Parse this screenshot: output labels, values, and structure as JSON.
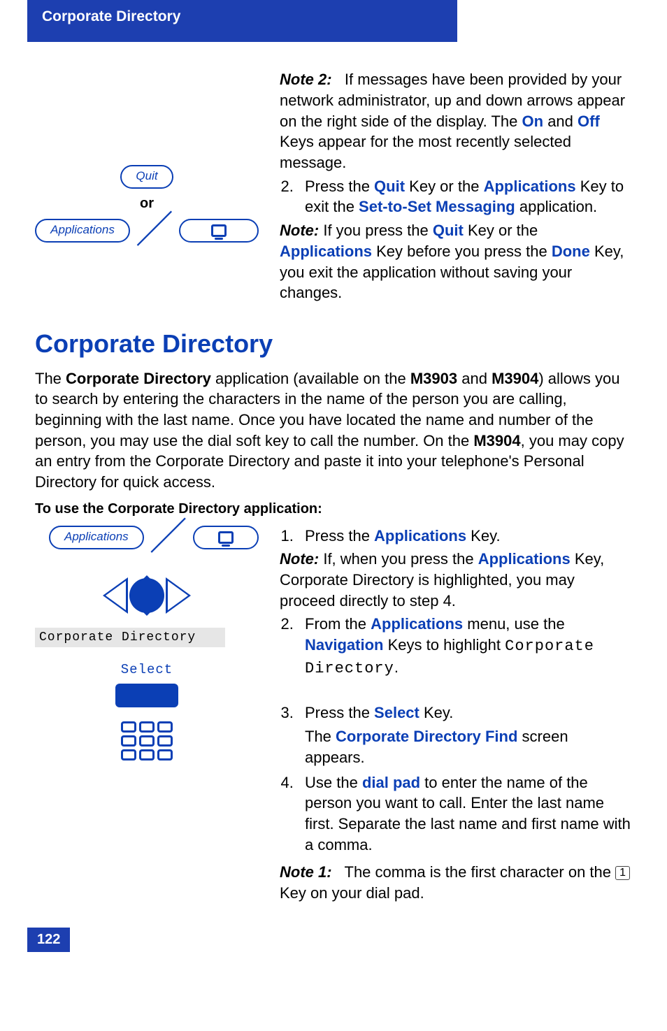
{
  "header": {
    "title": "Corporate Directory"
  },
  "upper": {
    "quit_label": "Quit",
    "or_label": "or",
    "applications_label": "Applications",
    "note2_label": "Note 2:",
    "note2_text": "If messages have been provided by your network administrator, up and down arrows appear on the right side of the display. The ",
    "on": "On",
    "and": " and ",
    "off": "Off",
    "note2_tail": " Keys appear for the most recently selected message.",
    "step2_pre": "Press the ",
    "quit_key": "Quit",
    "step2_mid": " Key or the ",
    "apps_key": "Applications",
    "step2_mid2": " Key to exit the ",
    "sts": "Set-to-Set Messaging",
    "step2_tail": " application.",
    "note_label": "Note:",
    "note_text1": " If you press the ",
    "note_text2": " Key or the ",
    "note_text3": " Key before you press the ",
    "done": "Done",
    "note_text4": " Key, you exit the application without saving your changes."
  },
  "section": {
    "title": "Corporate Directory",
    "intro_pre": "The ",
    "cd_bold": "Corporate Directory",
    "intro_mid1": " application (available on the ",
    "m3903": "M3903",
    "intro_and": " and ",
    "m3904": "M3904",
    "intro_mid2": ") allows you to search by entering the characters in the name of the person you are calling, beginning with the last name. Once you have located the name and number of the person, you may use the dial soft key to call the number. On the ",
    "intro_tail": ", you may copy an entry from the Corporate Directory and paste it into your telephone's Personal Directory for quick access.",
    "subtitle": "To use the Corporate Directory application:"
  },
  "steps": {
    "apps_label": "Applications",
    "lcd_cd": "Corporate Directory",
    "select_label": "Select",
    "s1_pre": "Press the ",
    "s1_key": "Applications",
    "s1_tail": " Key.",
    "s1_note_label": "Note:",
    "s1_note_pre": " If, when you press the ",
    "s1_note_tail": " Key, Corporate Directory is highlighted, you may proceed directly to step 4.",
    "s2_pre": "From the ",
    "s2_menu": "Applications",
    "s2_mid": " menu, use the ",
    "s2_nav": "Navigation",
    "s2_mid2": " Keys to highlight ",
    "s2_lcd": "Corporate Directory",
    "s2_period": ".",
    "s3_pre": "Press the ",
    "s3_key": "Select",
    "s3_tail": " Key.",
    "s3_body_pre": "The ",
    "s3_body_key": "Corporate Directory Find",
    "s3_body_tail": " screen appears.",
    "s4_pre": "Use the ",
    "s4_key": "dial pad",
    "s4_tail": " to enter the name of the person you want to call. Enter the last name first. Separate the last name and first name with a comma.",
    "note1_label": "Note 1:",
    "note1_pre": " The comma is the first character on the ",
    "note1_key": "1",
    "note1_tail": " Key on your dial pad."
  },
  "footer": {
    "page": "122"
  }
}
